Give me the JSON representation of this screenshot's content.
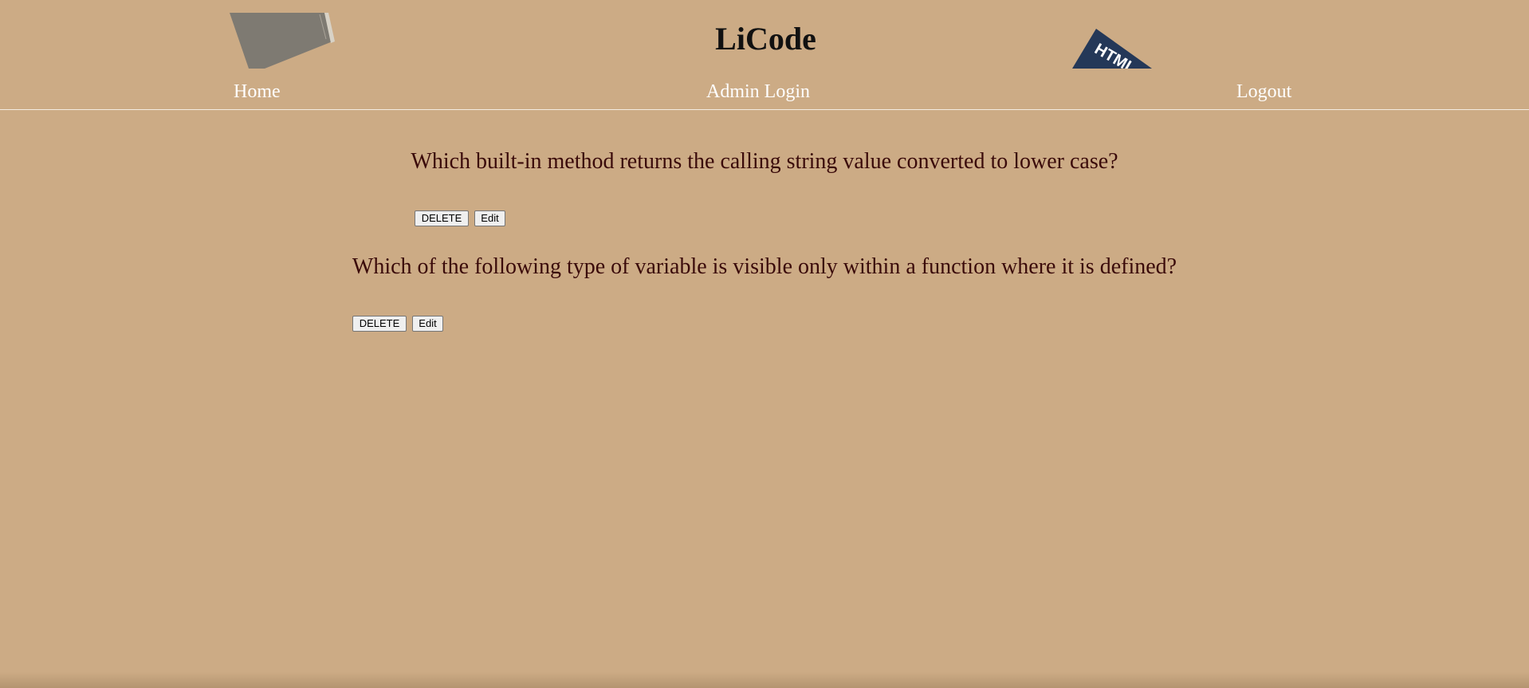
{
  "site": {
    "title": "LiCode"
  },
  "nav": {
    "home": "Home",
    "admin_login": "Admin Login",
    "logout": "Logout"
  },
  "logos": {
    "left": "book-logo",
    "right": "html-book-logo",
    "right_text": "HTML"
  },
  "questions": [
    {
      "text": "Which built-in method returns the calling string value converted to lower case?",
      "delete_label": "DELETE",
      "edit_label": "Edit"
    },
    {
      "text": "Which of the following type of variable is visible only within a function where it is defined?",
      "delete_label": "DELETE",
      "edit_label": "Edit"
    }
  ],
  "colors": {
    "background": "#ccab85",
    "title": "#111111",
    "nav_text": "#ffffff",
    "question_text": "#3a0a0a",
    "logo_right": "#243858",
    "logo_left": "#7e7a72"
  }
}
